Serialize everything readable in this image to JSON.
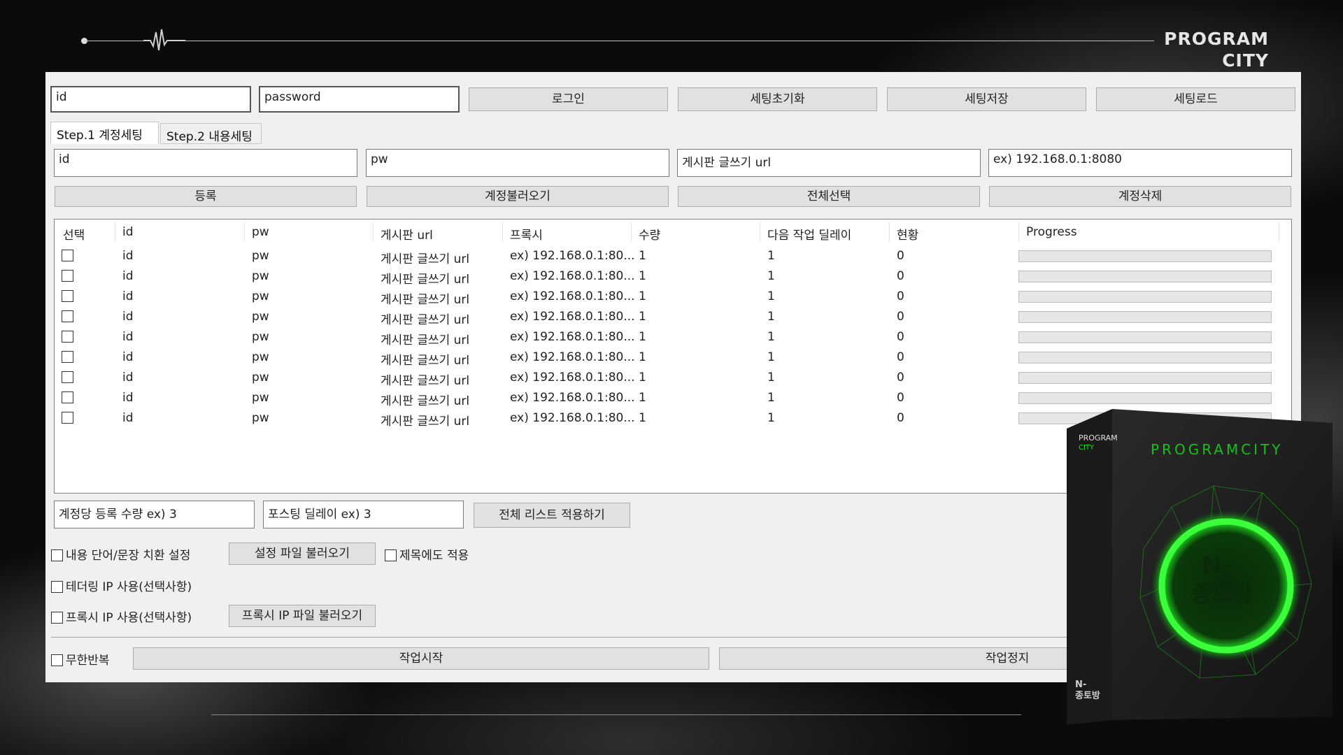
{
  "brand": {
    "line1": "PROGRAM",
    "line2": "CITY"
  },
  "login": {
    "id_value": "id",
    "password_value": "password",
    "buttons": [
      "로그인",
      "세팅초기화",
      "세팅저장",
      "세팅로드"
    ]
  },
  "tabs": [
    "Step.1 계정세팅",
    "Step.2 내용세팅"
  ],
  "account_inputs": {
    "id": "id",
    "pw": "pw",
    "url": "게시판 글쓰기 url",
    "proxy": "ex) 192.168.0.1:8080"
  },
  "account_buttons": [
    "등록",
    "계정불러오기",
    "전체선택",
    "계정삭제"
  ],
  "table": {
    "columns": [
      "선택",
      "id",
      "pw",
      "게시판 url",
      "프록시",
      "수량",
      "다음 작업 딜레이",
      "현황",
      "Progress"
    ],
    "rows": [
      {
        "id": "id",
        "pw": "pw",
        "url": "게시판 글쓰기 url",
        "proxy": "ex) 192.168.0.1:80...",
        "qty": "1",
        "delay": "1",
        "status": "0",
        "progress": 0
      },
      {
        "id": "id",
        "pw": "pw",
        "url": "게시판 글쓰기 url",
        "proxy": "ex) 192.168.0.1:80...",
        "qty": "1",
        "delay": "1",
        "status": "0",
        "progress": 0
      },
      {
        "id": "id",
        "pw": "pw",
        "url": "게시판 글쓰기 url",
        "proxy": "ex) 192.168.0.1:80...",
        "qty": "1",
        "delay": "1",
        "status": "0",
        "progress": 0
      },
      {
        "id": "id",
        "pw": "pw",
        "url": "게시판 글쓰기 url",
        "proxy": "ex) 192.168.0.1:80...",
        "qty": "1",
        "delay": "1",
        "status": "0",
        "progress": 0
      },
      {
        "id": "id",
        "pw": "pw",
        "url": "게시판 글쓰기 url",
        "proxy": "ex) 192.168.0.1:80...",
        "qty": "1",
        "delay": "1",
        "status": "0",
        "progress": 0
      },
      {
        "id": "id",
        "pw": "pw",
        "url": "게시판 글쓰기 url",
        "proxy": "ex) 192.168.0.1:80...",
        "qty": "1",
        "delay": "1",
        "status": "0",
        "progress": 0
      },
      {
        "id": "id",
        "pw": "pw",
        "url": "게시판 글쓰기 url",
        "proxy": "ex) 192.168.0.1:80...",
        "qty": "1",
        "delay": "1",
        "status": "0",
        "progress": 0
      },
      {
        "id": "id",
        "pw": "pw",
        "url": "게시판 글쓰기 url",
        "proxy": "ex) 192.168.0.1:80...",
        "qty": "1",
        "delay": "1",
        "status": "0",
        "progress": 0
      },
      {
        "id": "id",
        "pw": "pw",
        "url": "게시판 글쓰기 url",
        "proxy": "ex) 192.168.0.1:80...",
        "qty": "1",
        "delay": "1",
        "status": "0",
        "progress": 0
      }
    ]
  },
  "bulk": {
    "qty_value": "계정당 등록 수량 ex) 3",
    "delay_value": "포스팅 딜레이 ex) 3",
    "apply_button": "전체 리스트 적용하기"
  },
  "options": {
    "replace_label": "내용 단어/문장 치환 설정",
    "load_settings_button": "설정 파일 불러오기",
    "title_apply_label": "제목에도 적용",
    "tethering_label": "테더링 IP 사용(선택사항)",
    "proxy_label": "프록시 IP 사용(선택사항)",
    "load_proxy_button": "프록시 IP 파일 불러오기"
  },
  "run": {
    "loop_label": "무한반복",
    "start_button": "작업시작",
    "stop_button": "작업정지"
  },
  "product_box": {
    "top_label_1": "PROGRAM",
    "top_label_2": "CITY",
    "brand": "PROGRAMCITY",
    "title_1": "N-",
    "title_2": "종토방",
    "spine_1": "N-",
    "spine_2": "종토방"
  },
  "colors": {
    "accent_green": "#20e020",
    "progress_green": "#06b025"
  }
}
